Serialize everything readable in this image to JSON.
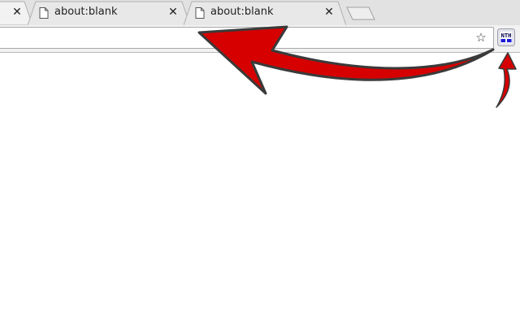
{
  "tabs": [
    {
      "title": "",
      "active": true
    },
    {
      "title": "about:blank",
      "active": false,
      "icon": "page-icon"
    },
    {
      "title": "about:blank",
      "active": false,
      "icon": "page-icon"
    }
  ],
  "tab_close_glyph": "✕",
  "omnibox": {
    "value": "",
    "placeholder": ""
  },
  "icons": {
    "bookmark": "star-icon",
    "extension": "NTH-extension-icon",
    "new_tab": "new-tab-icon"
  },
  "glyphs": {
    "star": "☆"
  },
  "colors": {
    "arrow_fill": "#d60000",
    "arrow_stroke": "#3a3a3a",
    "tabstrip_bg": "#e2e2e2",
    "active_tab_bg": "#f2f2f2"
  }
}
